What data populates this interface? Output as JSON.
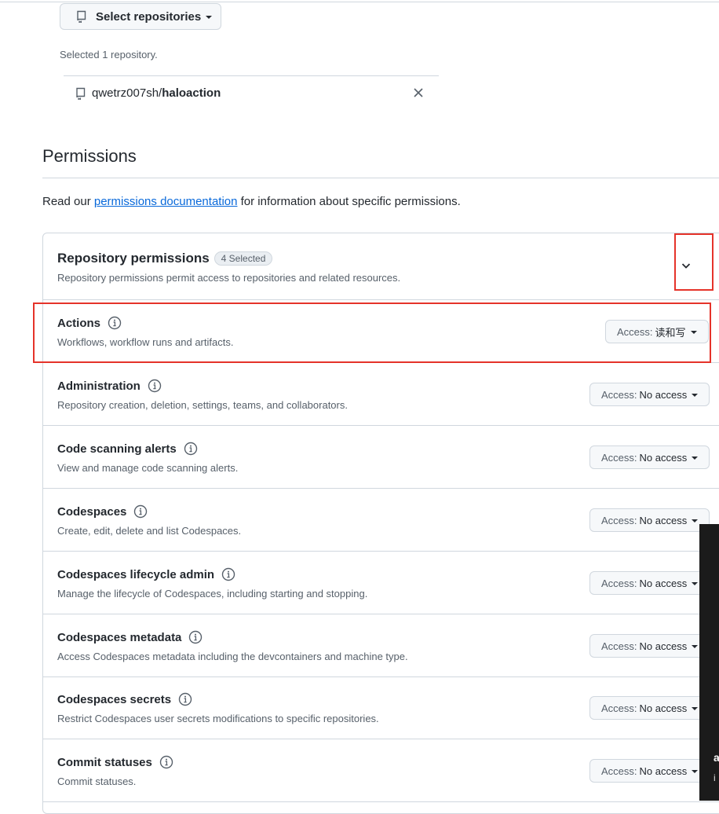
{
  "repo_selector": {
    "button_label": "Select repositories",
    "selected_count_text": "Selected 1 repository.",
    "repository": {
      "owner": "qwetrz007sh/",
      "name": "haloaction"
    }
  },
  "permissions": {
    "heading": "Permissions",
    "intro_before": "Read our ",
    "intro_link": "permissions documentation",
    "intro_after": " for information about specific permissions."
  },
  "repository_permissions": {
    "title": "Repository permissions",
    "counter": "4 Selected",
    "description": "Repository permissions permit access to repositories and related resources.",
    "items": [
      {
        "name": "Actions",
        "description": "Workflows, workflow runs and artifacts.",
        "access_prefix": "Access:",
        "access_value": "读和写"
      },
      {
        "name": "Administration",
        "description": "Repository creation, deletion, settings, teams, and collaborators.",
        "access_prefix": "Access:",
        "access_value": "No access"
      },
      {
        "name": "Code scanning alerts",
        "description": "View and manage code scanning alerts.",
        "access_prefix": "Access:",
        "access_value": "No access"
      },
      {
        "name": "Codespaces",
        "description": "Create, edit, delete and list Codespaces.",
        "access_prefix": "Access:",
        "access_value": "No access"
      },
      {
        "name": "Codespaces lifecycle admin",
        "description": "Manage the lifecycle of Codespaces, including starting and stopping.",
        "access_prefix": "Access:",
        "access_value": "No access"
      },
      {
        "name": "Codespaces metadata",
        "description": "Access Codespaces metadata including the devcontainers and machine type.",
        "access_prefix": "Access:",
        "access_value": "No access"
      },
      {
        "name": "Codespaces secrets",
        "description": "Restrict Codespaces user secrets modifications to specific repositories.",
        "access_prefix": "Access:",
        "access_value": "No access"
      },
      {
        "name": "Commit statuses",
        "description": "Commit statuses.",
        "access_prefix": "Access:",
        "access_value": "No access"
      }
    ]
  },
  "overlay": {
    "glyph1": "a",
    "glyph2": "i"
  },
  "colors": {
    "highlight": "#e5332a",
    "link": "#0969da",
    "border": "#d0d7de"
  },
  "icons": [
    "repo-icon",
    "close-icon",
    "chevron-down-icon",
    "info-icon",
    "caret-down-icon"
  ]
}
